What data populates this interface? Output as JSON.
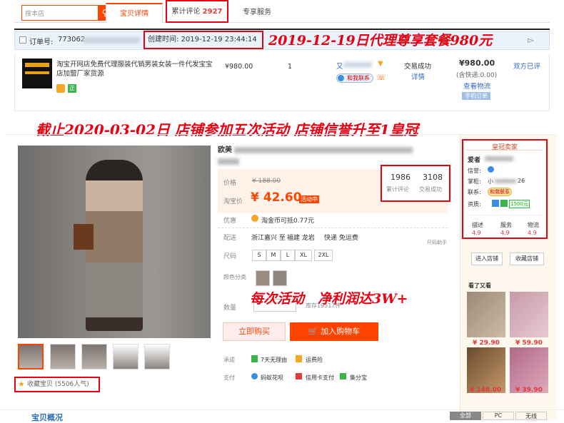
{
  "tabbar": {
    "search_placeholder": "搜本店",
    "search_icon": "search-icon",
    "tab1": "宝贝详情",
    "tab2_label": "累计评论",
    "tab2_count": "2927",
    "tab3": "专享服务"
  },
  "order": {
    "order_no_label": "订单号:",
    "order_no": "773062",
    "created": "创建时间: 2019-12-19 23:44:14",
    "anno": "2019-12-19日代理尊享套餐980元",
    "title": "淘宝开网店免费代理服装代销男装女装一件代发宝宝店加盟厂家货源",
    "price": "¥980.00",
    "qty": "1",
    "seller": "又",
    "contact": "和我联系",
    "status": "交易成功",
    "detail": "详情",
    "paid": "¥980.00",
    "freight": "(含快递:0.00)",
    "snapshot": "查看物流",
    "mobile": "手机订单",
    "rated": "双方已评",
    "badge_zheng": "正"
  },
  "anno2": "截止2020-03-02日 店铺参加五次活动 店铺信誉升至1皇冠",
  "product": {
    "title": "欧美",
    "price_label": "价格",
    "price": "¥ 188.00",
    "promo_label": "淘宝价",
    "promo": "¥ 42.60",
    "promo_tag": "活动中",
    "perk_label": "优惠",
    "perk": "淘金币可抵0.77元",
    "ship_label": "配送",
    "ship_from": "浙江嘉兴 至",
    "ship_to": "福建 龙岩",
    "ship_type": "快递 免运费",
    "size_label": "尺码",
    "size_chart": "尺码助手",
    "sizes": [
      "S",
      "M",
      "L",
      "XL",
      "2XL"
    ],
    "color_label": "颜色分类",
    "qty_label": "数量",
    "stock": "库存19517件",
    "reviews": "1986",
    "reviews_label": "累计评论",
    "sales": "3108",
    "sales_label": "交易成功",
    "buy": "立即购买",
    "cart": "加入购物车",
    "promise_label": "承诺",
    "promise1": "7天无理由",
    "promise2": "运费险",
    "pay_label": "支付",
    "pay1": "蚂蚁花呗",
    "pay2": "信用卡支付",
    "pay3": "集分宝",
    "fav": "收藏宝贝 (5506人气)"
  },
  "anno3": "每次活动　净利润达3W+",
  "shop": {
    "title": "皇冠卖家",
    "name": "爱者",
    "credit_label": "信誉:",
    "keeper_label": "掌柜:",
    "keeper": "小",
    "keeper_suffix": "26",
    "contact_label": "联系:",
    "contact": "和我联系",
    "quals_label": "资质:",
    "deposit": "1500元",
    "desc_label": "描述",
    "desc": "4.9",
    "svc_label": "服务",
    "svc": "4.9",
    "log_label": "物流",
    "log": "4.9",
    "enter": "进入店铺",
    "collect": "收藏店铺"
  },
  "rec": {
    "title": "看了又看",
    "prices": [
      "¥ 29.90",
      "¥ 59.90",
      "¥ 148.00",
      "¥ 39.90"
    ]
  },
  "bottom": {
    "tab1": "宝贝概况",
    "seg1": "全部",
    "seg2": "PC",
    "seg3": "无线"
  }
}
